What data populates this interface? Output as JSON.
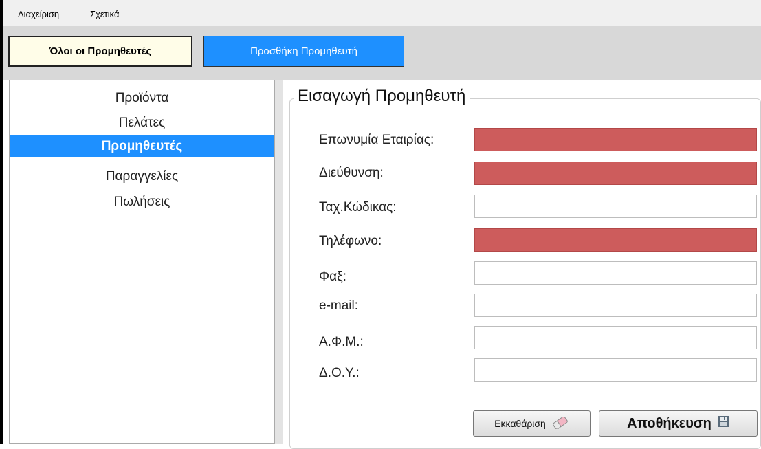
{
  "menu": {
    "items": [
      "Διαχείριση",
      "Σχετικά"
    ]
  },
  "toolbar": {
    "all_suppliers": "Όλοι οι Προμηθευτές",
    "add_supplier": "Προσθήκη Προμηθευτή"
  },
  "sidebar": {
    "items": [
      "Προϊόντα",
      "Πελάτες",
      "Προμηθευτές",
      "Παραγγελίες",
      "Πωλήσεις"
    ],
    "active": "Προμηθευτές"
  },
  "form": {
    "title": "Εισαγωγή Προμηθευτή",
    "fields": [
      {
        "label": "Επωνυμία Εταιρίας:",
        "value": "",
        "required": true
      },
      {
        "label": "Διεύθυνση:",
        "value": "",
        "required": true
      },
      {
        "label": "Ταχ.Κώδικας:",
        "value": "",
        "required": false
      },
      {
        "label": "Τηλέφωνο:",
        "value": "",
        "required": true
      },
      {
        "label": "Φαξ:",
        "value": "",
        "required": false
      },
      {
        "label": "e-mail:",
        "value": "",
        "required": false
      },
      {
        "label": "Α.Φ.Μ.:",
        "value": "",
        "required": false
      },
      {
        "label": "Δ.Ο.Υ.:",
        "value": "",
        "required": false
      }
    ],
    "clear_label": "Εκκαθάριση",
    "save_label": "Αποθήκευση"
  },
  "colors": {
    "accent": "#1e90ff",
    "required_field": "#cd5c5c",
    "all_button_bg": "#fffde8"
  },
  "icons": {
    "clear": "eraser-icon",
    "save": "floppy-disk-icon"
  }
}
